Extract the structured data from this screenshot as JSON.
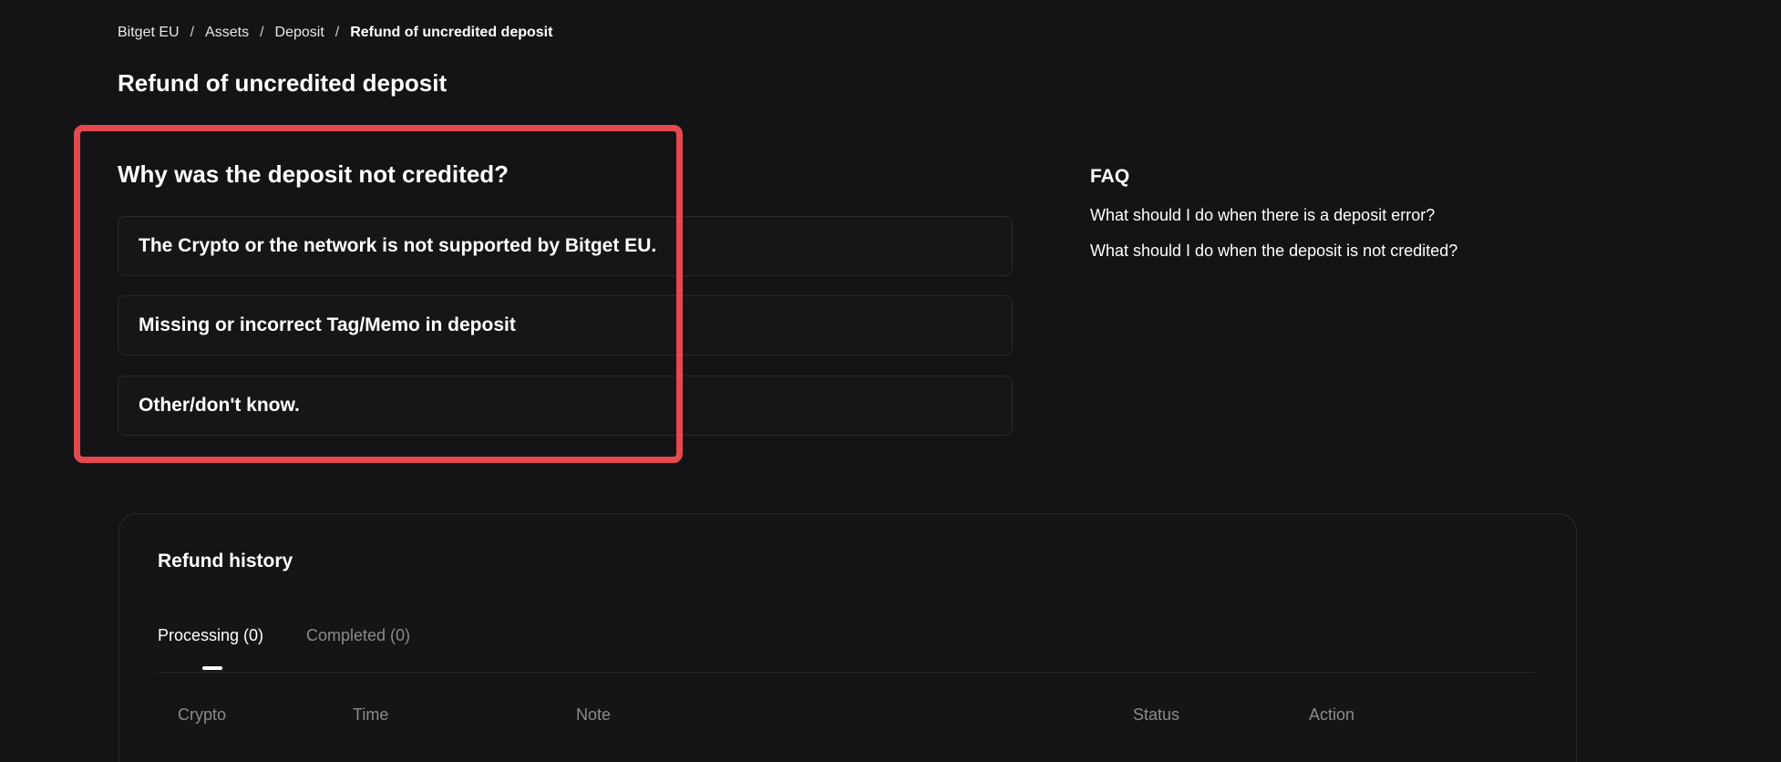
{
  "breadcrumb": {
    "items": [
      "Bitget EU",
      "Assets",
      "Deposit"
    ],
    "current": "Refund of uncredited deposit",
    "separator": "/"
  },
  "page": {
    "title": "Refund of uncredited deposit"
  },
  "reasons": {
    "title": "Why was the deposit not credited?",
    "options": [
      "The Crypto or the network is not supported by Bitget EU.",
      "Missing or incorrect Tag/Memo in deposit",
      "Other/don't know."
    ]
  },
  "faq": {
    "title": "FAQ",
    "links": [
      "What should I do when there is a deposit error?",
      "What should I do when the deposit is not credited?"
    ]
  },
  "history": {
    "title": "Refund history",
    "tabs": [
      {
        "label": "Processing (0)",
        "active": true
      },
      {
        "label": "Completed (0)",
        "active": false
      }
    ],
    "columns": [
      "Crypto",
      "Time",
      "Note",
      "Status",
      "Action"
    ]
  },
  "colors": {
    "background": "#141416",
    "highlight": "#e5484d",
    "border": "#2a2a2e",
    "muted_text": "#8a8a90"
  }
}
